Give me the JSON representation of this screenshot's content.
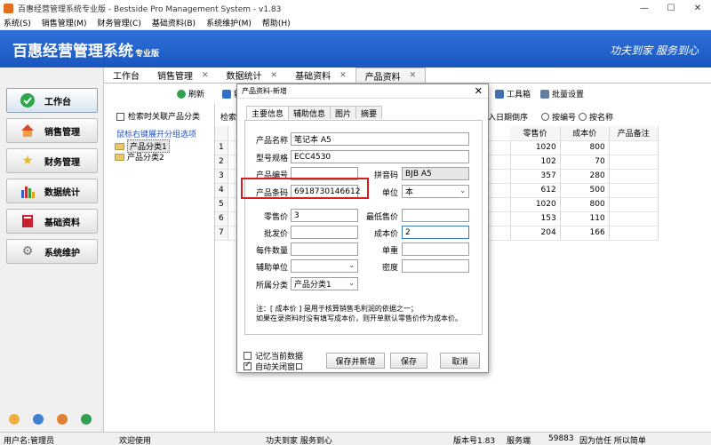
{
  "window": {
    "title": "百惠经营管理系统专业版 - Bestside Pro Management System - v1.83",
    "controls": [
      "—",
      "☐",
      "✕"
    ]
  },
  "menu": [
    "系统(S)",
    "销售管理(M)",
    "财务管理(C)",
    "基础资料(B)",
    "系统维护(M)",
    "帮助(H)"
  ],
  "banner": {
    "logo": "百惠经营管理系统",
    "logo_suffix": "专业版",
    "slogan": "功夫到家  服务到心"
  },
  "nav": [
    {
      "label": "工作台",
      "icon": "check-circle-icon",
      "color": "#2aa84a"
    },
    {
      "label": "销售管理",
      "icon": "house-icon",
      "color": "#d84a2a"
    },
    {
      "label": "财务管理",
      "icon": "star-icon",
      "color": "#e8b820"
    },
    {
      "label": "数据统计",
      "icon": "bar-chart-icon",
      "color": "#3060c8"
    },
    {
      "label": "基础资料",
      "icon": "book-icon",
      "color": "#c82030"
    },
    {
      "label": "系统维护",
      "icon": "gear-icon",
      "color": "#808080"
    }
  ],
  "tabs": [
    {
      "label": "工作台",
      "closable": false
    },
    {
      "label": "销售管理",
      "closable": true
    },
    {
      "label": "数据统计",
      "closable": true
    },
    {
      "label": "基础资料",
      "closable": true
    },
    {
      "label": "产品资料",
      "closable": true,
      "active": true
    }
  ],
  "toolbar": {
    "refresh": "刷新",
    "new_partial": "新",
    "toolbox": "工具箱",
    "batch": "批量设置"
  },
  "left_panel": {
    "checkbox_label": "检索时关联产品分类",
    "hint": "鼠标右键展开分组选项",
    "tree": [
      "产品分类1",
      "产品分类2"
    ]
  },
  "filter": {
    "search_partial": "检索",
    "sort_partial": "入日期倒序",
    "sort_by_code": "按编号",
    "sort_by_name": "按名称"
  },
  "grid": {
    "columns": [
      "零售价",
      "成本价",
      "产品备注"
    ],
    "rows": [
      {
        "n": "1",
        "retail": "1020",
        "cost": "800"
      },
      {
        "n": "2",
        "retail": "102",
        "cost": "70"
      },
      {
        "n": "3",
        "retail": "357",
        "cost": "280"
      },
      {
        "n": "4",
        "retail": "612",
        "cost": "500"
      },
      {
        "n": "5",
        "retail": "1020",
        "cost": "800"
      },
      {
        "n": "6",
        "retail": "153",
        "cost": "110"
      },
      {
        "n": "7",
        "retail": "204",
        "cost": "166"
      }
    ]
  },
  "dialog": {
    "title": "产品资料-新增",
    "tabs": [
      "主要信息",
      "辅助信息",
      "图片",
      "摘要"
    ],
    "fields": {
      "name_label": "产品名称",
      "name_value": "笔记本 A5",
      "model_label": "型号规格",
      "model_value": "ECC4530",
      "code_label": "产品编号",
      "code_value": "",
      "pinyin_label": "拼音码",
      "pinyin_value": "BJB A5",
      "barcode_label": "产品条码",
      "barcode_value": "6918730146612",
      "unit_label": "单位",
      "unit_value": "本",
      "retail_label": "零售价",
      "retail_value": "3",
      "min_price_label": "最低售价",
      "min_price_value": "",
      "wholesale_label": "批发价",
      "wholesale_value": "",
      "cost_label": "成本价",
      "cost_value": "2",
      "per_qty_label": "每件数量",
      "per_qty_value": "",
      "weight_label": "单重",
      "weight_value": "",
      "aux_unit_label": "辅助单位",
      "aux_unit_value": "",
      "density_label": "密度",
      "density_value": "",
      "category_label": "所属分类",
      "category_value": "产品分类1"
    },
    "note_line1": "注：[ 成本价 ] 是用于核算销售毛利润的依据之一；",
    "note_line2": "如果在录资料时没有填写成本价，则开单默认零售价作为成本价。",
    "remember_label": "记忆当前数据",
    "autoclose_label": "自动关闭窗口",
    "btn_save_new": "保存并新增",
    "btn_save": "保存",
    "btn_cancel": "取消"
  },
  "status": {
    "user": "用户名:管理员",
    "welcome": "欢迎使用",
    "slogan": "功夫到家 服务到心",
    "version": "版本号1.83",
    "server_label": "服务端",
    "port": "59883",
    "tagline": "因为信任 所以简单"
  }
}
